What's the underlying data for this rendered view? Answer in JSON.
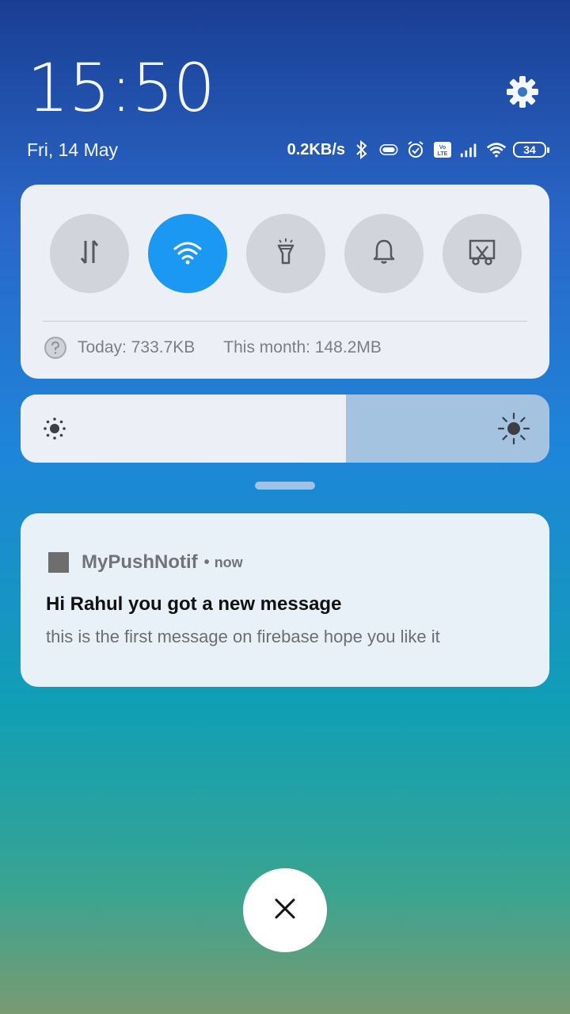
{
  "header": {
    "time": "15:50",
    "date": "Fri, 14 May",
    "network_speed": "0.2KB/s",
    "battery_level": "34"
  },
  "icons": {
    "settings": "gear-icon",
    "bluetooth": "bluetooth-icon",
    "signal": "signal-icon",
    "wifi": "wifi-icon"
  },
  "quick_settings": {
    "toggles": [
      {
        "name": "mobile-data",
        "icon": "data-transfer-icon",
        "active": false
      },
      {
        "name": "wifi",
        "icon": "wifi-icon",
        "active": true
      },
      {
        "name": "flashlight",
        "icon": "flashlight-icon",
        "active": false
      },
      {
        "name": "sound",
        "icon": "bell-icon",
        "active": false
      },
      {
        "name": "screenshot",
        "icon": "scissors-icon",
        "active": false
      }
    ],
    "usage_today": "Today: 733.7KB",
    "usage_month": "This month: 148.2MB"
  },
  "brightness": {
    "level": 0.615
  },
  "notification": {
    "app_name": "MyPushNotif",
    "separator": "•",
    "time": "now",
    "title": "Hi Rahul you got a new message",
    "body": "this is the first message on firebase hope you like it"
  },
  "colors": {
    "accent": "#1a98f2",
    "card": "#eceff6",
    "notification_bg": "#e9f1f8"
  }
}
